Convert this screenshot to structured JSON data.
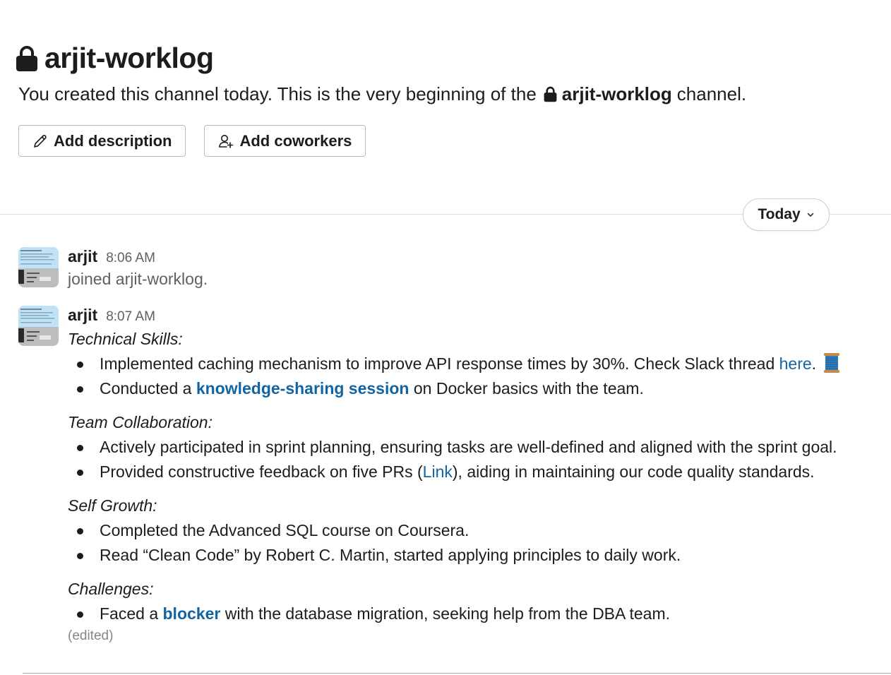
{
  "channel": {
    "name": "arjit-worklog",
    "intro_prefix": "You created this channel today. This is the very beginning of the",
    "intro_channel": "arjit-worklog",
    "intro_suffix": "channel.",
    "add_description_label": "Add description",
    "add_coworkers_label": "Add coworkers"
  },
  "divider": {
    "date_label": "Today"
  },
  "messages": [
    {
      "author": "arjit",
      "time": "8:06 AM",
      "text": "joined arjit-worklog."
    },
    {
      "author": "arjit",
      "time": "8:07 AM",
      "sections": [
        {
          "title": "Technical Skills:",
          "items": [
            {
              "pre": "Implemented caching mechanism to improve API response times by 30%. Check Slack thread ",
              "link": "here",
              "post": "."
            },
            {
              "pre": "Conducted a ",
              "link": "knowledge-sharing session",
              "post": " on Docker basics with the team."
            }
          ]
        },
        {
          "title": "Team Collaboration:",
          "items": [
            {
              "pre": "Actively participated in sprint planning, ensuring tasks are well-defined and aligned with the sprint goal."
            },
            {
              "pre": "Provided constructive feedback on five PRs (",
              "link": "Link",
              "post": "), aiding in maintaining our code quality standards."
            }
          ]
        },
        {
          "title": "Self Growth:",
          "items": [
            {
              "pre": "Completed the Advanced SQL course on Coursera."
            },
            {
              "pre": "Read “Clean Code” by Robert C. Martin, started applying principles to daily work."
            }
          ]
        },
        {
          "title": "Challenges:",
          "items": [
            {
              "pre": "Faced a ",
              "link": "blocker",
              "post": " with the database migration, seeking help from the DBA team."
            }
          ]
        }
      ],
      "edited_label": "(edited)",
      "emoji": "spool-of-thread"
    }
  ],
  "colors": {
    "link": "#1264a3",
    "text": "#1d1c1d",
    "muted": "#616061"
  }
}
